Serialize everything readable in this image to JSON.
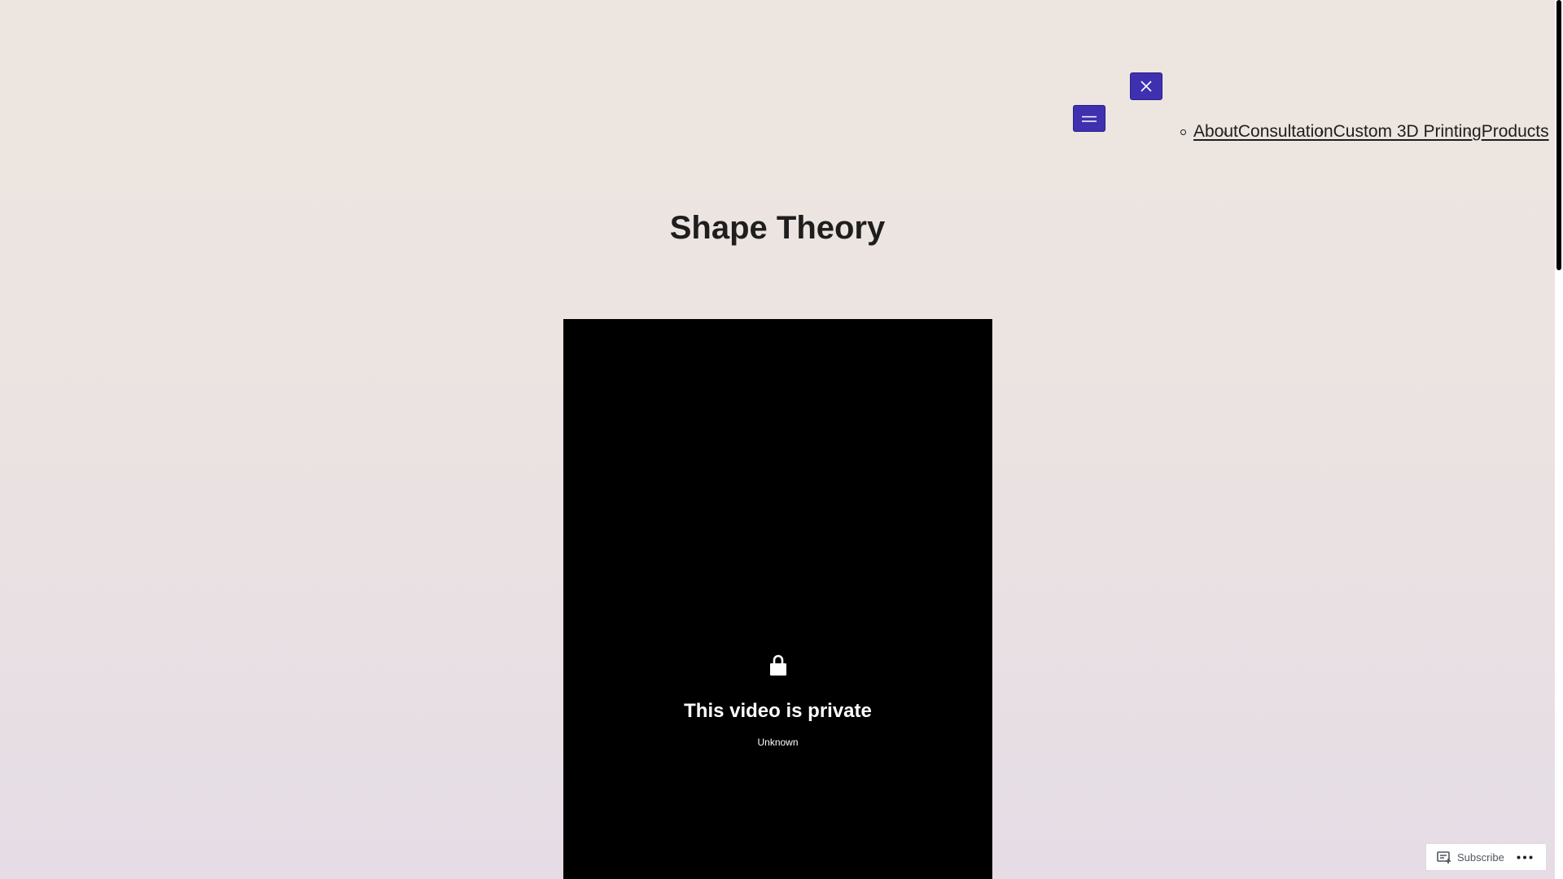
{
  "header": {
    "nav_items": [
      {
        "label": "About"
      },
      {
        "label": "Consultation"
      },
      {
        "label": "Custom 3D Printing"
      },
      {
        "label": "Products"
      }
    ]
  },
  "site_title": "Shape Theory",
  "video": {
    "title": "This video is private",
    "subtitle": "Unknown"
  },
  "subscribe_bar": {
    "subscribe_label": "Subscribe"
  },
  "colors": {
    "menu_button": "#3f30b0",
    "video_background": "#000000",
    "page_background_top": "#ede6e0",
    "page_background_bottom": "#e5dce6"
  }
}
